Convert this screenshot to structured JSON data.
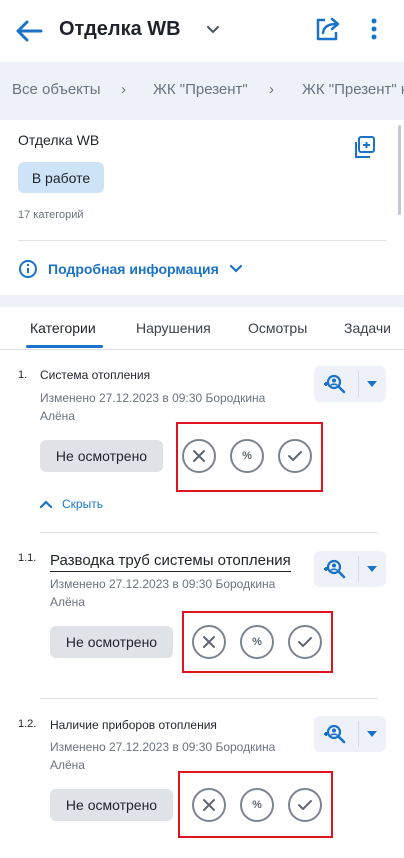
{
  "header": {
    "title": "Отделка WB"
  },
  "breadcrumbs": [
    "Все объекты",
    "ЖК \"Презент\"",
    "ЖК \"Презент\" к"
  ],
  "object": {
    "name": "Отделка WB",
    "status": "В работе",
    "categories_count": "17 категорий",
    "details_link": "Подробная информация"
  },
  "tabs": [
    "Категории",
    "Нарушения",
    "Осмотры",
    "Задачи"
  ],
  "categories": [
    {
      "number": "1.",
      "title": "Система отопления",
      "meta": "Изменено 27.12.2023 в 09:30 Бородкина Алёна",
      "status": "Не осмотрено",
      "hide_label": "Скрыть"
    },
    {
      "number": "1.1.",
      "title": "Разводка труб системы отопления",
      "meta": "Изменено 27.12.2023 в 09:30 Бородкина Алёна",
      "status": "Не осмотрено"
    },
    {
      "number": "1.2.",
      "title": "Наличие приборов отопления",
      "meta": "Изменено 27.12.2023 в 09:30 Бородкина Алёна",
      "status": "Не осмотрено"
    }
  ],
  "percent_symbol": "%",
  "colors": {
    "accent": "#1a73c9",
    "highlight": "#e0141e",
    "band": "#eef2f8"
  }
}
